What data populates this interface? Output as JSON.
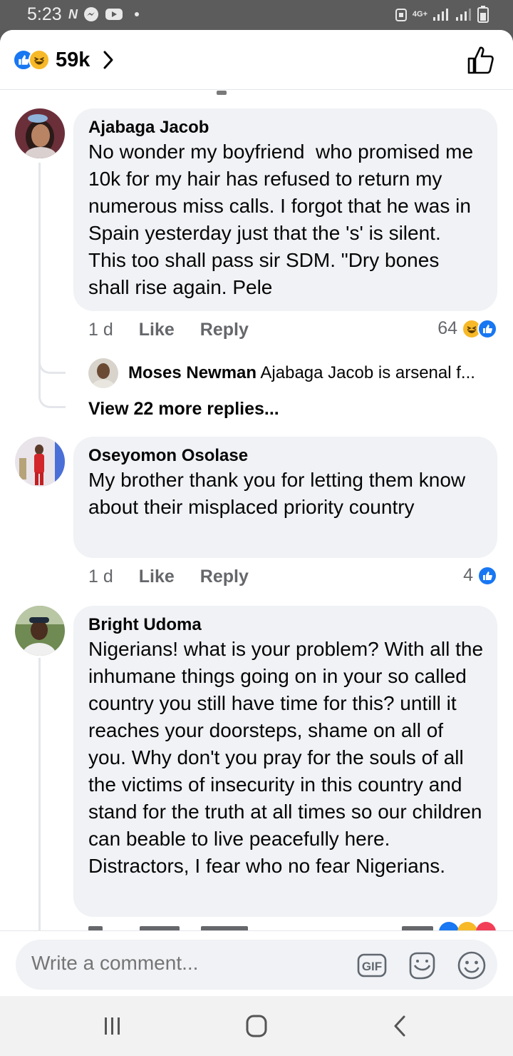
{
  "status_bar": {
    "time": "5:23",
    "left_icons": [
      "n-icon",
      "messenger-icon",
      "youtube-icon",
      "dot-icon"
    ],
    "network": "4G+"
  },
  "header": {
    "reaction_count": "59k",
    "reactions": [
      "like",
      "haha"
    ]
  },
  "comments": [
    {
      "author": "Ajabaga Jacob",
      "text": "No wonder my boyfriend  who promised me 10k for my hair has refused to return my numerous miss calls. I forgot that he was in Spain yesterday just that the 's' is silent. This too shall pass sir SDM. \"Dry bones shall rise again. Pele",
      "time": "1 d",
      "like_label": "Like",
      "reply_label": "Reply",
      "reaction_count": "64",
      "reactions": [
        "haha",
        "like"
      ],
      "reply_preview": {
        "author": "Moses Newman",
        "text": "Ajabaga Jacob is arsenal f..."
      },
      "view_more": "View 22 more replies..."
    },
    {
      "author": "Oseyomon Osolase",
      "text": "My brother thank you for letting them know about their misplaced priority country",
      "time": "1 d",
      "like_label": "Like",
      "reply_label": "Reply",
      "reaction_count": "4",
      "reactions": [
        "like"
      ]
    },
    {
      "author": "Bright Udoma",
      "text": "Nigerians! what is your problem? With all the inhumane things going on in your so called country you still have time for this? untill it reaches your doorsteps, shame on all of you. Why don't you pray for the souls of all the victims of insecurity in this country and stand for the truth at all times so our children can beable to live peacefully here. Distractors, I fear who no fear Nigerians.",
      "reactions": [
        "like",
        "haha",
        "love"
      ]
    }
  ],
  "composer": {
    "placeholder": "Write a comment...",
    "gif_label": "GIF"
  },
  "colors": {
    "accent": "#1877f2",
    "bubble": "#f0f2f5",
    "meta_text": "#65676b",
    "haha": "#f7b928",
    "love": "#f33e58"
  },
  "nav": [
    "recents-button",
    "home-button",
    "back-button"
  ]
}
